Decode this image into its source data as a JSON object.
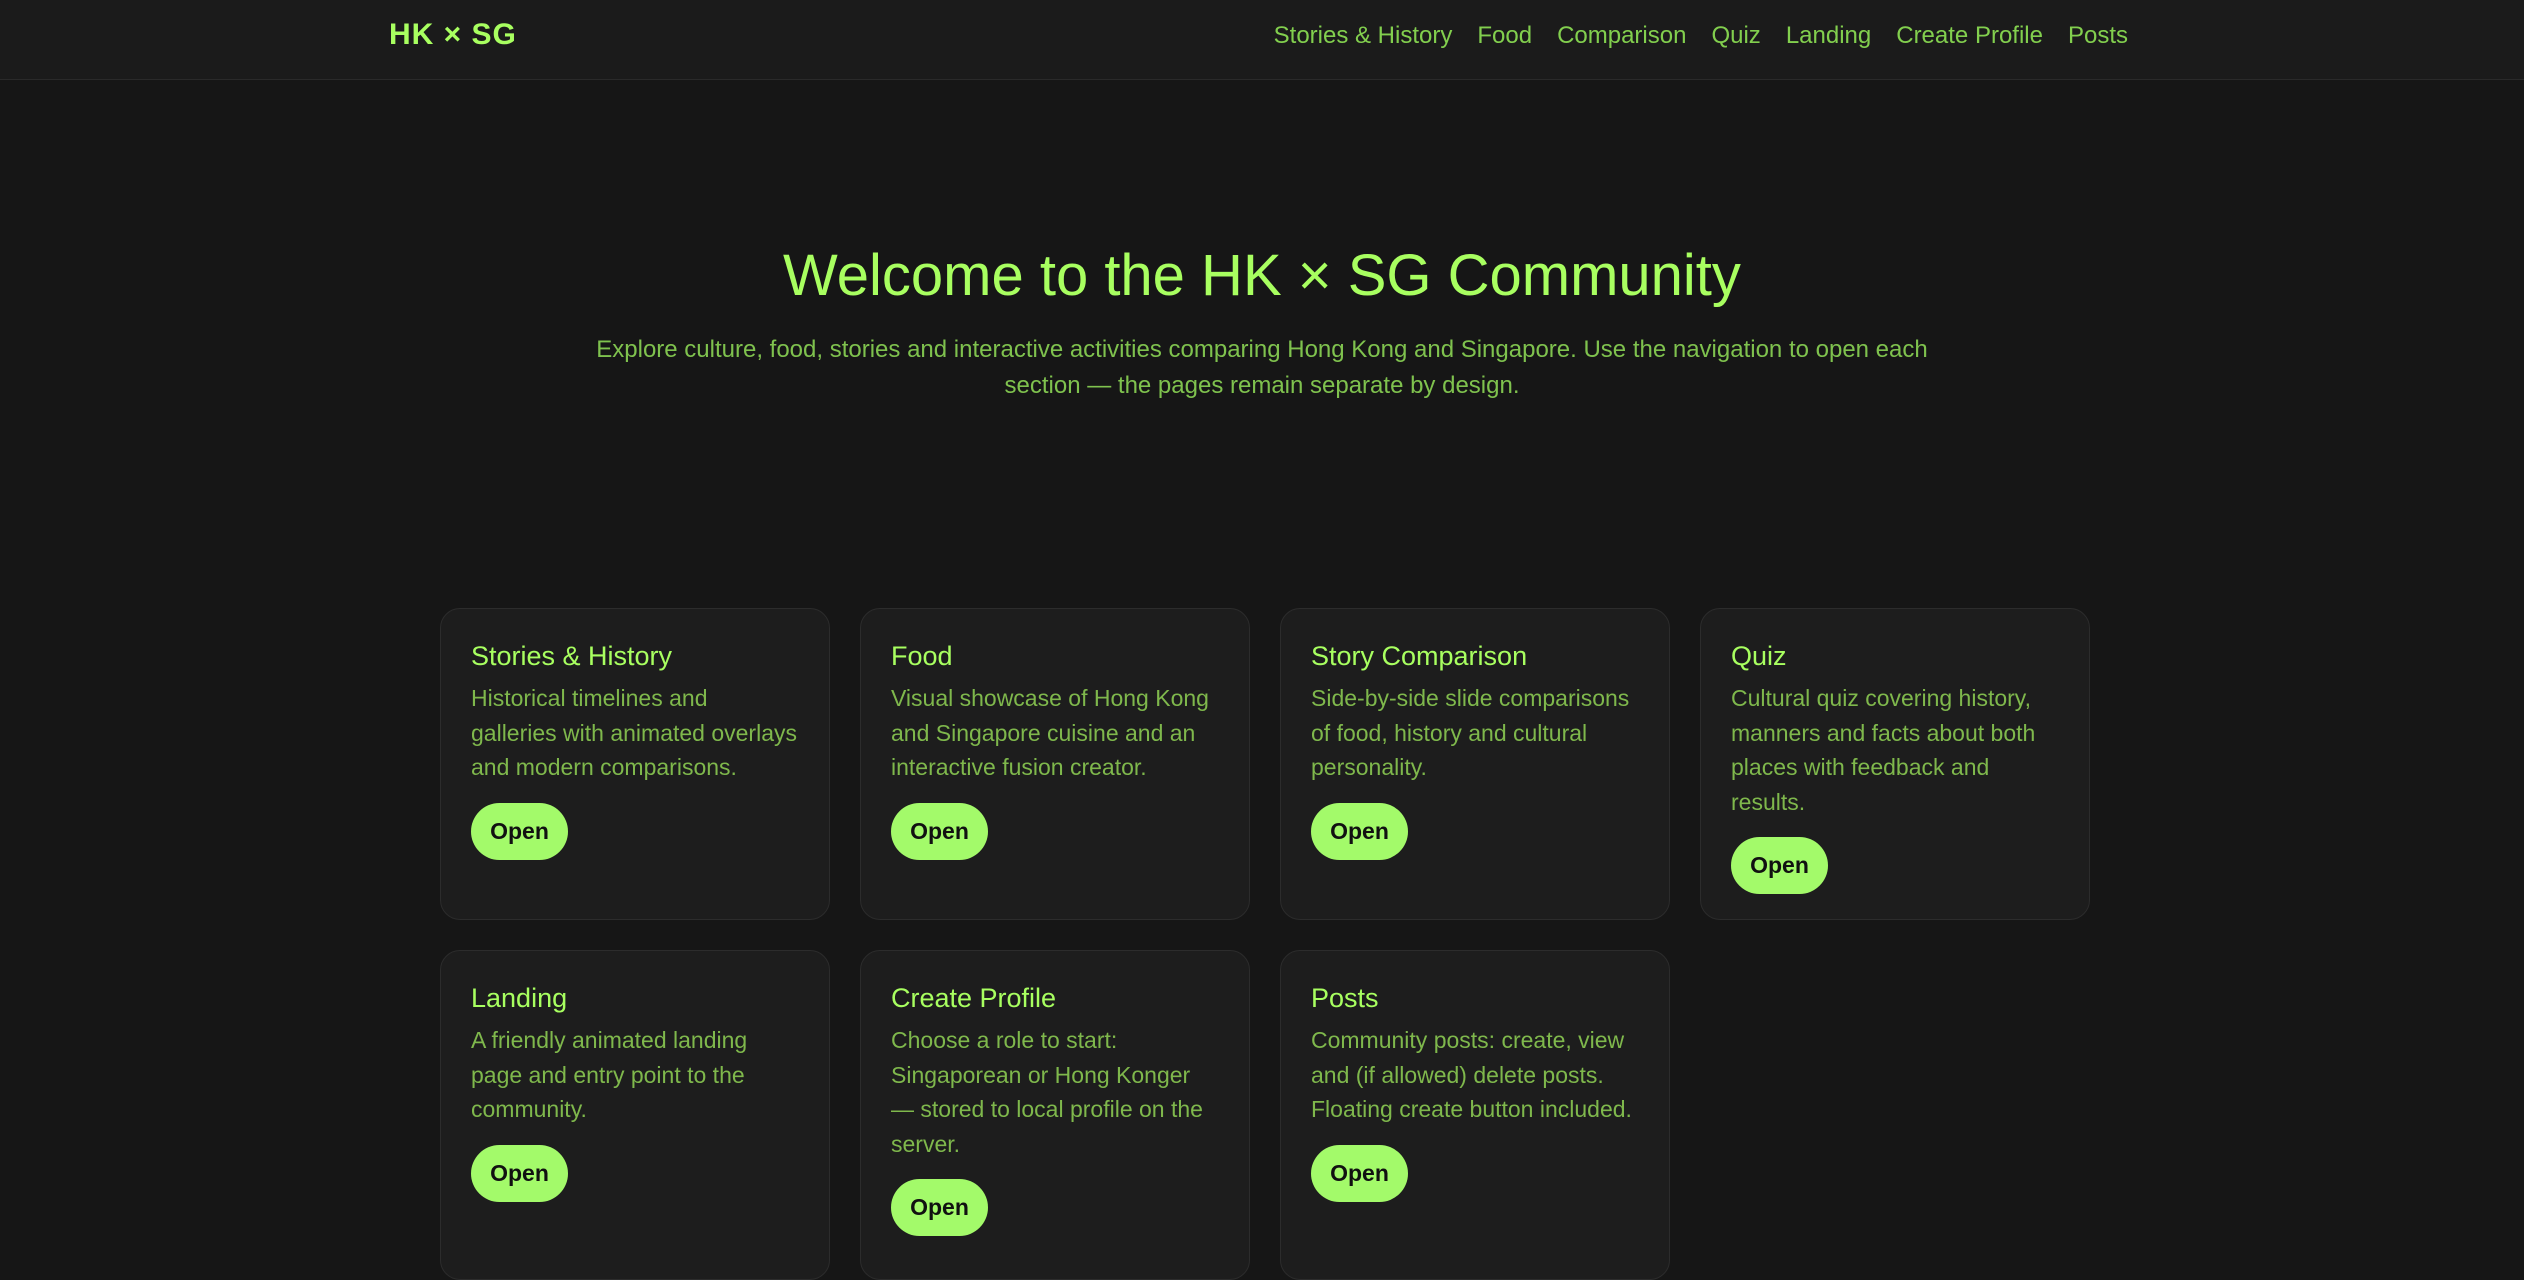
{
  "nav": {
    "brand": "HK × SG",
    "links": [
      "Stories & History",
      "Food",
      "Comparison",
      "Quiz",
      "Landing",
      "Create Profile",
      "Posts"
    ]
  },
  "hero": {
    "title": "Welcome to the HK × SG Community",
    "subtitle": "Explore culture, food, stories and interactive activities comparing Hong Kong and Singapore. Use the navigation to open each section — the pages remain separate by design."
  },
  "cards": [
    {
      "title": "Stories & History",
      "description": "Historical timelines and galleries with animated overlays and modern comparisons.",
      "button": "Open"
    },
    {
      "title": "Food",
      "description": "Visual showcase of Hong Kong and Singapore cuisine and an interactive fusion creator.",
      "button": "Open"
    },
    {
      "title": "Story Comparison",
      "description": "Side-by-side slide comparisons of food, history and cultural personality.",
      "button": "Open"
    },
    {
      "title": "Quiz",
      "description": "Cultural quiz covering history, manners and facts about both places with feedback and results.",
      "button": "Open"
    },
    {
      "title": "Landing",
      "description": "A friendly animated landing page and entry point to the community.",
      "button": "Open"
    },
    {
      "title": "Create Profile",
      "description": "Choose a role to start: Singaporean or Hong Konger — stored to local profile on the server.",
      "button": "Open"
    },
    {
      "title": "Posts",
      "description": "Community posts: create, view and (if allowed) delete posts. Floating create button included.",
      "button": "Open"
    }
  ],
  "colors": {
    "background": "#161616",
    "accent": "#a8ff60",
    "muted_green": "#7fb84c",
    "button": "#a3fa6a"
  }
}
